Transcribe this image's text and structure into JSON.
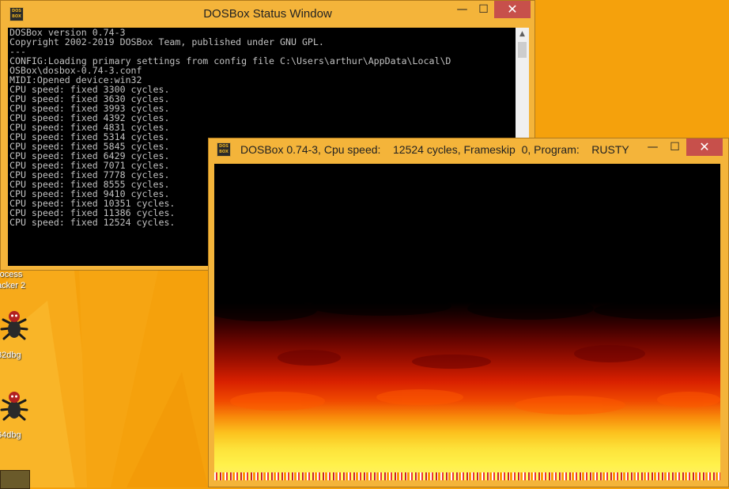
{
  "colors": {
    "desktop": "#f5a10c",
    "window_frame": "#f4b43a",
    "close_button": "#c7504b",
    "console_bg": "#000000",
    "console_text": "#c0c0c0"
  },
  "desktop": {
    "icons": [
      {
        "label_line1": "rocess",
        "label_line2": "acker 2",
        "icon": "process-hacker-icon"
      },
      {
        "label_line1": "32dbg",
        "icon": "bug-icon"
      },
      {
        "label_line1": "64dbg",
        "icon": "bug-icon"
      }
    ]
  },
  "status_window": {
    "title": "DOSBox Status Window",
    "icon_text": "DOS BOX",
    "controls": {
      "minimize": "—",
      "maximize": "☐",
      "close": "✕"
    },
    "console_lines": [
      "DOSBox version 0.74-3",
      "Copyright 2002-2019 DOSBox Team, published under GNU GPL.",
      "---",
      "CONFIG:Loading primary settings from config file C:\\Users\\arthur\\AppData\\Local\\D",
      "OSBox\\dosbox-0.74-3.conf",
      "MIDI:Opened device:win32",
      "CPU speed: fixed 3300 cycles.",
      "CPU speed: fixed 3630 cycles.",
      "CPU speed: fixed 3993 cycles.",
      "CPU speed: fixed 4392 cycles.",
      "CPU speed: fixed 4831 cycles.",
      "CPU speed: fixed 5314 cycles.",
      "CPU speed: fixed 5845 cycles.",
      "CPU speed: fixed 6429 cycles.",
      "CPU speed: fixed 7071 cycles.",
      "CPU speed: fixed 7778 cycles.",
      "CPU speed: fixed 8555 cycles.",
      "CPU speed: fixed 9410 cycles.",
      "CPU speed: fixed 10351 cycles.",
      "CPU speed: fixed 11386 cycles.",
      "CPU speed: fixed 12524 cycles."
    ],
    "scroll_up": "▲",
    "scroll_down": "▼"
  },
  "game_window": {
    "title": "DOSBox 0.74-3, Cpu speed:    12524 cycles, Frameskip  0, Program:    RUSTY",
    "icon_text": "DOS BOX",
    "controls": {
      "minimize": "—",
      "maximize": "☐",
      "close": "✕"
    },
    "screen_content": "fire-effect"
  }
}
